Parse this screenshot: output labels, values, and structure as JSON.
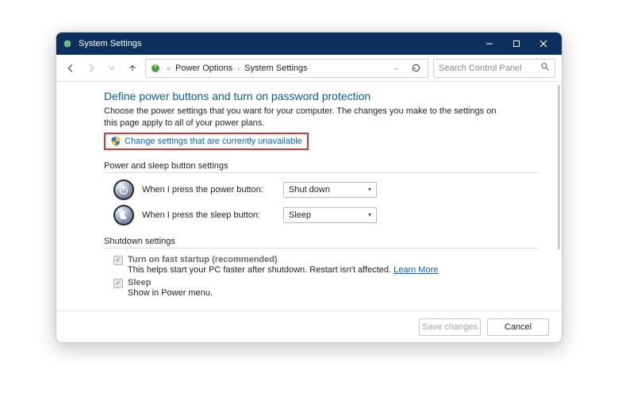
{
  "window": {
    "title": "System Settings"
  },
  "breadcrumb": {
    "item1": "Power Options",
    "item2": "System Settings"
  },
  "search": {
    "placeholder": "Search Control Panel"
  },
  "page": {
    "heading": "Define power buttons and turn on password protection",
    "description": "Choose the power settings that you want for your computer. The changes you make to the settings on this page apply to all of your power plans.",
    "change_link": "Change settings that are currently unavailable"
  },
  "section1": {
    "label": "Power and sleep button settings",
    "power_label": "When I press the power button:",
    "power_value": "Shut down",
    "sleep_label": "When I press the sleep button:",
    "sleep_value": "Sleep"
  },
  "section2": {
    "label": "Shutdown settings",
    "fast_label": "Turn on fast startup (recommended)",
    "fast_desc": "This helps start your PC faster after shutdown. Restart isn't affected. ",
    "learn_more": "Learn More",
    "sleep_label": "Sleep",
    "sleep_desc": "Show in Power menu."
  },
  "footer": {
    "save": "Save changes",
    "cancel": "Cancel"
  }
}
